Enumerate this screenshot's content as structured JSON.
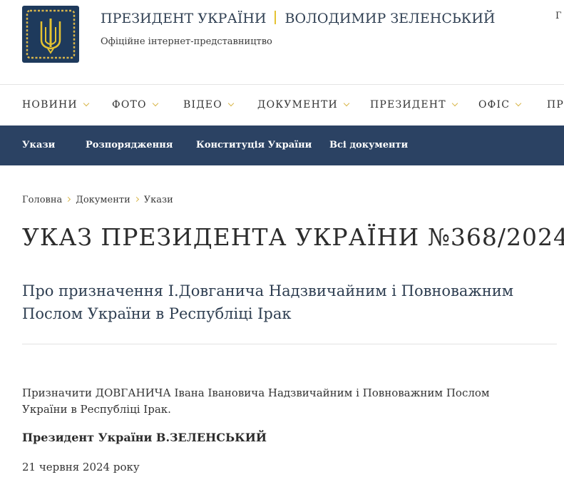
{
  "header": {
    "brand_title": "ПРЕЗИДЕНТ УКРАЇНИ",
    "brand_name": "ВОЛОДИМИР ЗЕЛЕНСЬКИЙ",
    "brand_subtitle": "Офіційне інтернет-представництво",
    "logo_icon": "trident-emblem-icon",
    "corner_text": "Г"
  },
  "colors": {
    "nav_bar": "#2b4263",
    "accent_gold": "#d9b64a",
    "logo_bg": "#1e3a5c"
  },
  "main_nav": [
    {
      "label": "НОВИНИ"
    },
    {
      "label": "ФОТО"
    },
    {
      "label": "ВІДЕО"
    },
    {
      "label": "ДОКУМЕНТИ"
    },
    {
      "label": "ПРЕЗИДЕНТ"
    },
    {
      "label": "ОФІС"
    },
    {
      "label": "ПРЕ"
    }
  ],
  "sub_nav": [
    {
      "label": "Укази"
    },
    {
      "label": "Розпорядження"
    },
    {
      "label": "Конституція України"
    },
    {
      "label": "Всі документи"
    }
  ],
  "breadcrumb": [
    {
      "label": "Головна"
    },
    {
      "label": "Документи"
    },
    {
      "label": "Укази"
    }
  ],
  "document": {
    "title": "УКАЗ ПРЕЗИДЕНТА УКРАЇНИ №368/2024",
    "subtitle": "Про призначення І.Довганича Надзвичайним і Повноважним Послом України в Республіці Ірак",
    "body": "Призначити ДОВГАНИЧА Івана Івановича Надзвичайним і Повноважним Послом України в Республіці Ірак.",
    "signature": "Президент України В.ЗЕЛЕНСЬКИЙ",
    "date": "21 червня 2024 року"
  }
}
